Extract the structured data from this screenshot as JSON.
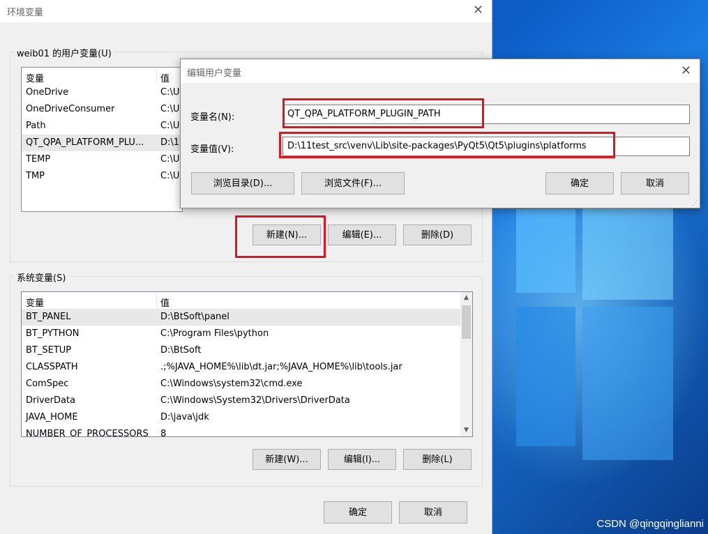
{
  "main_dialog": {
    "title": "环境变量",
    "user_group_label": "weib01 的用户变量(U)",
    "system_group_label": "系统变量(S)",
    "columns": {
      "name": "变量",
      "value": "值"
    },
    "user_vars": [
      {
        "name": "OneDrive",
        "value": "C:\\U"
      },
      {
        "name": "OneDriveConsumer",
        "value": "C:\\U"
      },
      {
        "name": "Path",
        "value": "C:\\U"
      },
      {
        "name": "QT_QPA_PLATFORM_PLU...",
        "value": "D:\\1"
      },
      {
        "name": "TEMP",
        "value": "C:\\U"
      },
      {
        "name": "TMP",
        "value": "C:\\U"
      }
    ],
    "user_buttons": {
      "new": "新建(N)...",
      "edit": "编辑(E)...",
      "delete": "删除(D)"
    },
    "system_vars": [
      {
        "name": "BT_PANEL",
        "value": "D:\\BtSoft\\panel"
      },
      {
        "name": "BT_PYTHON",
        "value": "C:\\Program Files\\python"
      },
      {
        "name": "BT_SETUP",
        "value": "D:\\BtSoft"
      },
      {
        "name": "CLASSPATH",
        "value": ".;%JAVA_HOME%\\lib\\dt.jar;%JAVA_HOME%\\lib\\tools.jar"
      },
      {
        "name": "ComSpec",
        "value": "C:\\Windows\\system32\\cmd.exe"
      },
      {
        "name": "DriverData",
        "value": "C:\\Windows\\System32\\Drivers\\DriverData"
      },
      {
        "name": "JAVA_HOME",
        "value": "D:\\java\\jdk"
      },
      {
        "name": "NUMBER_OF_PROCESSORS",
        "value": "8"
      }
    ],
    "system_buttons": {
      "new": "新建(W)...",
      "edit": "编辑(I)...",
      "delete": "删除(L)"
    },
    "ok": "确定",
    "cancel": "取消"
  },
  "edit_dialog": {
    "title": "编辑用户变量",
    "name_label": "变量名(N):",
    "name_value": "QT_QPA_PLATFORM_PLUGIN_PATH",
    "value_label": "变量值(V):",
    "value_value": "D:\\11test_src\\venv\\Lib\\site-packages\\PyQt5\\Qt5\\plugins\\platforms",
    "browse_dir": "浏览目录(D)...",
    "browse_file": "浏览文件(F)...",
    "ok": "确定",
    "cancel": "取消"
  },
  "watermark": "CSDN @qingqinglianni",
  "colors": {
    "highlight": "#e0141e",
    "accent": "#0078d7"
  }
}
